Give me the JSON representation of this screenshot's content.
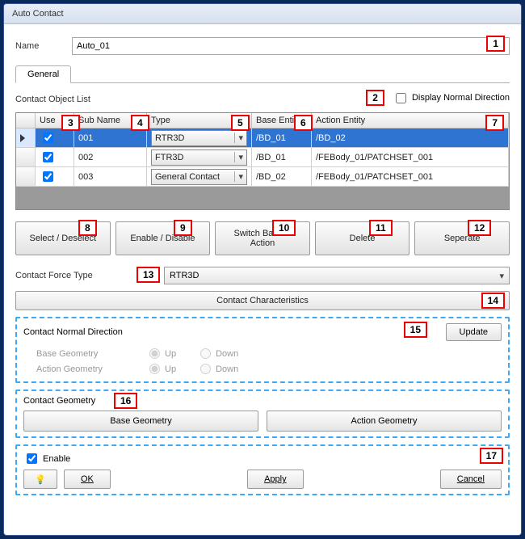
{
  "window": {
    "title": "Auto Contact"
  },
  "name": {
    "label": "Name",
    "value": "Auto_01"
  },
  "tabs": {
    "general": "General"
  },
  "objectList": {
    "label": "Contact Object List",
    "displayNormalLabel": "Display Normal Direction",
    "displayNormalChecked": false,
    "headers": {
      "use": "Use",
      "sub": "Sub Name",
      "type": "Type",
      "base": "Base Entity",
      "action": "Action Entity"
    },
    "rows": [
      {
        "use": true,
        "sub": "001",
        "type": "RTR3D",
        "base": "/BD_01",
        "action": "/BD_02",
        "selected": true
      },
      {
        "use": true,
        "sub": "002",
        "type": "FTR3D",
        "base": "/BD_01",
        "action": "/FEBody_01/PATCHSET_001",
        "selected": false
      },
      {
        "use": true,
        "sub": "003",
        "type": "General Contact",
        "base": "/BD_02",
        "action": "/FEBody_01/PATCHSET_001",
        "selected": false
      }
    ]
  },
  "buttons": {
    "selectDeselect": "Select / Deselect",
    "enableDisable": "Enable / Disable",
    "switchBaseAction": "Switch Base & Action",
    "delete": "Delete",
    "separate": "Seperate"
  },
  "forceType": {
    "label": "Contact Force Type",
    "value": "RTR3D"
  },
  "characteristics": {
    "label": "Contact Characteristics"
  },
  "normalDir": {
    "label": "Contact Normal Direction",
    "update": "Update",
    "baseLabel": "Base Geometry",
    "actionLabel": "Action Geometry",
    "up": "Up",
    "down": "Down"
  },
  "geometry": {
    "label": "Contact Geometry",
    "base": "Base Geometry",
    "action": "Action Geometry"
  },
  "footer": {
    "enable": "Enable",
    "enableChecked": true,
    "ok": "OK",
    "apply": "Apply",
    "cancel": "Cancel"
  },
  "callouts": {
    "c1": "1",
    "c2": "2",
    "c3": "3",
    "c4": "4",
    "c5": "5",
    "c6": "6",
    "c7": "7",
    "c8": "8",
    "c9": "9",
    "c10": "10",
    "c11": "11",
    "c12": "12",
    "c13": "13",
    "c14": "14",
    "c15": "15",
    "c16": "16",
    "c17": "17"
  }
}
